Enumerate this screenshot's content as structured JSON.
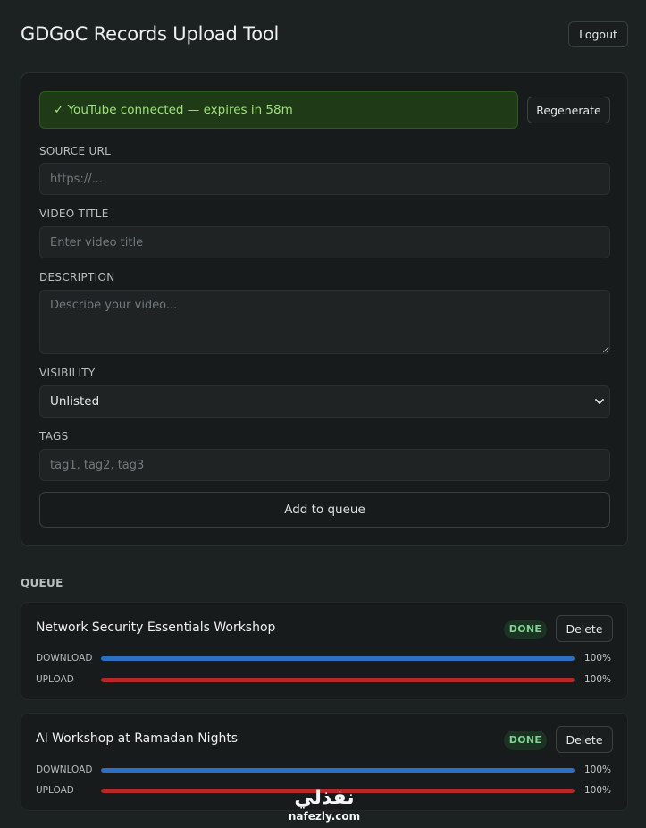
{
  "header": {
    "title": "GDGoC Records Upload Tool",
    "logout_label": "Logout"
  },
  "status": {
    "text": "✓ YouTube connected — expires in 58m",
    "regenerate_label": "Regenerate"
  },
  "form": {
    "source_url": {
      "label": "SOURCE URL",
      "placeholder": "https://...",
      "value": ""
    },
    "video_title": {
      "label": "VIDEO TITLE",
      "placeholder": "Enter video title",
      "value": ""
    },
    "description": {
      "label": "DESCRIPTION",
      "placeholder": "Describe your video...",
      "value": ""
    },
    "visibility": {
      "label": "VISIBILITY",
      "selected": "Unlisted"
    },
    "tags": {
      "label": "TAGS",
      "placeholder": "tag1, tag2, tag3",
      "value": ""
    },
    "submit_label": "Add to queue"
  },
  "queue": {
    "heading": "QUEUE",
    "items": [
      {
        "title": "Network Security Essentials Workshop",
        "status": "DONE",
        "delete_label": "Delete",
        "download": {
          "label": "DOWNLOAD",
          "progress": 100,
          "percent_text": "100%"
        },
        "upload": {
          "label": "UPLOAD",
          "progress": 100,
          "percent_text": "100%"
        }
      },
      {
        "title": "AI Workshop at Ramadan Nights",
        "status": "DONE",
        "delete_label": "Delete",
        "download": {
          "label": "DOWNLOAD",
          "progress": 100,
          "percent_text": "100%"
        },
        "upload": {
          "label": "UPLOAD",
          "progress": 100,
          "percent_text": "100%"
        }
      }
    ]
  },
  "watermark": {
    "logo_text": "نفذلي",
    "url": "nafezly.com"
  },
  "colors": {
    "background": "#1c2121",
    "status_bg": "#1e3a16",
    "status_text": "#9fe27c",
    "done_badge_text": "#7fd491",
    "download_bar": "#2c6fc4",
    "upload_bar": "#b7262b"
  }
}
